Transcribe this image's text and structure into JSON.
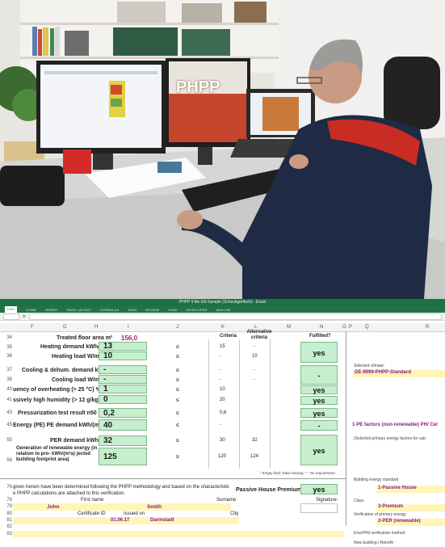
{
  "photo": {
    "monitor_logo": "PHPP"
  },
  "excel": {
    "window_title": "PHPP 9 file EN Sample (Scheckgerfisch) - Excel",
    "ribbon_tabs": [
      "FILE",
      "HOME",
      "INSERT",
      "PAGE LAYOUT",
      "FORMULAS",
      "DATA",
      "REVIEW",
      "VIEW",
      "DEVELOPER",
      "ADD-INS"
    ],
    "formula_fx": "fx",
    "columns": [
      "F",
      "G",
      "H",
      "I",
      "J",
      "K",
      "L",
      "M",
      "N",
      "O",
      "P",
      "Q",
      "R"
    ],
    "header": {
      "criteria": "Criteria",
      "alt_criteria": "Alternative criteria",
      "fulfilled": "Fulfilled?"
    },
    "rows": [
      {
        "num": "34",
        "label": "Treated floor area m²",
        "value": "156,0"
      },
      {
        "num": "35",
        "label": "Heating demand kWh/(m²a)",
        "value": "13",
        "op": "≤",
        "crit": "15",
        "alt": "-"
      },
      {
        "num": "36",
        "label": "Heating load W/m²",
        "value": "10",
        "op": "≤",
        "crit": "-",
        "alt": "10",
        "fulfilled": "yes"
      },
      {
        "num": "37",
        "label": "Cooling & dehum. demand kWh/(m²a)",
        "value": "-",
        "op": "≤",
        "crit": "-",
        "alt": "-"
      },
      {
        "num": "38",
        "label": "Cooling load W/m²",
        "value": "-",
        "op": "≤",
        "crit": "-",
        "alt": "-",
        "fulfilled": "-"
      },
      {
        "num": "40",
        "label": "uency of overheating (> 25 °C) %",
        "value": "1",
        "op": "≤",
        "crit": "10",
        "fulfilled": "yes"
      },
      {
        "num": "41",
        "label": "ssively high humidity (> 12 g/kg) %",
        "value": "0",
        "op": "≤",
        "crit": "20",
        "fulfilled": "yes"
      },
      {
        "num": "43",
        "label": "Pressurization test result n50 1/h",
        "value": "0,2",
        "op": "≤",
        "crit": "0,6",
        "fulfilled": "yes"
      },
      {
        "num": "45",
        "label": "Energy (PE)   PE demand kWh/(m²a)",
        "value": "40",
        "op": "≤",
        "crit": "-",
        "fulfilled": "-"
      },
      {
        "num": "55",
        "label": "PER demand kWh/(m²a)",
        "value": "32",
        "op": "≤",
        "crit": "30",
        "alt": "32"
      },
      {
        "num": "56",
        "label": "Generation of renewable energy (in relation to pro- kWh/(m²a) jected building footprint area)",
        "value": "125",
        "op": "≥",
        "crit": "120",
        "alt": "124",
        "fulfilled": "yes"
      }
    ],
    "side": {
      "selected_climate_label": "Selected climate:",
      "selected_climate_value": "DE-9999-PHPP-Standard",
      "pe_factors": "1-PE factors (non-renewable) PH/ Cer",
      "selected_pe": "(Selected primary energy factors for calc"
    },
    "footnote": "² Empty field: Data missing; '-': No requirement",
    "certification": {
      "statement_1": "given herein have been determined following the PHPP methodology and based on the characteristic",
      "statement_2": "e PHPP calculations are attached to this verification.",
      "question": "Passive House Premium?",
      "answer": "yes",
      "first_name_label": "First name",
      "surname_label": "Surname",
      "signature_label": "Signature:",
      "first_name": "John",
      "surname": "Smith",
      "certificate_label": "Certificate ID",
      "issued_label": "Issued on",
      "city_label": "City",
      "issued_on": "01.06.17",
      "city": "Darmstadt",
      "row_nums": [
        "76",
        "78",
        "79",
        "80",
        "81",
        "82",
        "83"
      ]
    },
    "standard_panel": {
      "title": "Building energy standard",
      "standard_value": "1-Passive House",
      "class_label": "Class",
      "class_value": "3-Premium",
      "verification_label": "Verification of primary energy",
      "verification_value": "2-PER (renewable)",
      "enerphit_label": "EnerPHit verification method",
      "new_building_label": "New building / Retrofit"
    }
  }
}
